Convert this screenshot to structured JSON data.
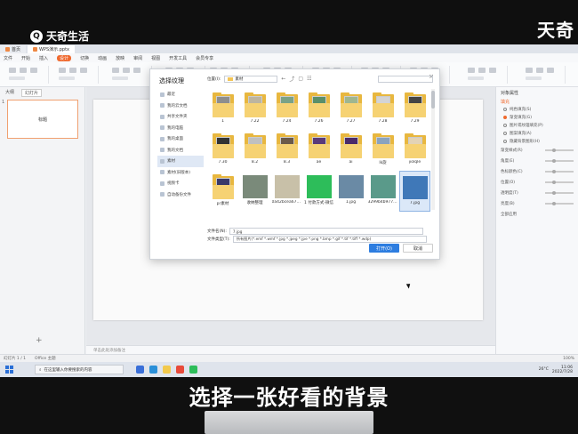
{
  "watermark": {
    "left_brand": "天奇生活",
    "right_brand": "天奇"
  },
  "window": {
    "tabs": [
      "首页",
      "WPS演示.pptx"
    ],
    "menu": [
      "文件",
      "开始",
      "插入",
      "设计",
      "切换",
      "动画",
      "放映",
      "审阅",
      "视图",
      "开发工具",
      "会员专享"
    ],
    "menu_highlight": "设计"
  },
  "left_panel": {
    "tabs": [
      "大纲",
      "幻灯片"
    ],
    "active_tab": "幻灯片",
    "thumb_title": "标题",
    "thumb_number": "1",
    "add_button": "+"
  },
  "notes_placeholder": "单击此处添加备注",
  "status_bar": {
    "slide_info": "幻灯片 1 / 1",
    "theme": "Office 主题",
    "zoom": "100%"
  },
  "right_panel": {
    "title": "对象属性",
    "section": "填充",
    "options": [
      {
        "label": "纯色填充(S)",
        "selected": false
      },
      {
        "label": "渐变填充(G)",
        "selected": true
      },
      {
        "label": "图片或纹理填充(P)",
        "selected": false
      },
      {
        "label": "图案填充(A)",
        "selected": false
      },
      {
        "label": "隐藏背景图形(H)",
        "selected": false
      }
    ],
    "rows": [
      "渐变样式(R)",
      "角度(E)",
      "色标颜色(C)",
      "位置(O)",
      "透明度(T)",
      "亮度(B)"
    ],
    "apply_all": "全部应用"
  },
  "dialog": {
    "title": "选择纹理",
    "location_label": "位置(I):",
    "location_value": "素材",
    "sidebar": [
      {
        "label": "最近",
        "selected": false
      },
      {
        "label": "我的云文档",
        "selected": false
      },
      {
        "label": "共享文件夹",
        "selected": false
      },
      {
        "label": "我的电脑",
        "selected": false
      },
      {
        "label": "我的桌面",
        "selected": false
      },
      {
        "label": "我的文档",
        "selected": false
      },
      {
        "label": "素材",
        "selected": true
      },
      {
        "label": "素材(旧版本)",
        "selected": false
      },
      {
        "label": "视频卡",
        "selected": false
      },
      {
        "label": "自动备份文件",
        "selected": false
      }
    ],
    "files": [
      {
        "name": "1",
        "kind": "folder",
        "art": "#8e8e8e"
      },
      {
        "name": "7.22",
        "kind": "folder",
        "art": "#bdb5a0"
      },
      {
        "name": "7.24",
        "kind": "folder",
        "art": "#7aa287"
      },
      {
        "name": "7.26",
        "kind": "folder",
        "art": "#5a8f6a"
      },
      {
        "name": "7.27",
        "kind": "folder",
        "art": "#9fb68f"
      },
      {
        "name": "7.28",
        "kind": "folder",
        "art": "#d4d4d4"
      },
      {
        "name": "7.29",
        "kind": "folder",
        "art": "#444444"
      },
      {
        "name": "7.30",
        "kind": "folder",
        "art": "#333333"
      },
      {
        "name": "8.2",
        "kind": "folder",
        "art": "#c0c0c0"
      },
      {
        "name": "8.3",
        "kind": "folder",
        "art": "#6b5a4a"
      },
      {
        "name": "ae",
        "kind": "folder",
        "art": "#5a3a7a"
      },
      {
        "name": "ai",
        "kind": "folder",
        "art": "#4a2a6a"
      },
      {
        "name": "lk旋",
        "kind": "folder",
        "art": "#8aa3bf"
      },
      {
        "name": "jiolqle",
        "kind": "folder",
        "art": "#e3d3b5"
      },
      {
        "name": "pr素材",
        "kind": "folder",
        "art": "#3a3a6a"
      },
      {
        "name": "收纳整理",
        "kind": "photo",
        "art": "#7a8a7a"
      },
      {
        "name": "0a42bcea67099...",
        "kind": "photo",
        "art": "#c8c0a8"
      },
      {
        "name": "1 付款方式-微信",
        "kind": "photo",
        "art": "#2dbd5a"
      },
      {
        "name": "1.jpg",
        "kind": "photo",
        "art": "#6a8aa5"
      },
      {
        "name": "3299b4b97703d...",
        "kind": "photo",
        "art": "#5a9a8a"
      },
      {
        "name": "7.jpg",
        "kind": "photo",
        "art": "#3f78b8"
      }
    ],
    "selected_file": "7.jpg",
    "filename_label": "文件名(N):",
    "filename_value": "7.jpg",
    "filetype_label": "文件类型(T):",
    "filetype_value": "所有图片(*.emf *.wmf *.jpg *.jpeg *.jpe *.png *.bmp *.gif *.tif *.tiff *.wdp)",
    "open_button": "打开(O)",
    "cancel_button": "取消"
  },
  "taskbar": {
    "search_placeholder": "在这里输入你要搜索的内容",
    "weather": "26°C",
    "time": "11:06",
    "date": "2022/7/28"
  },
  "subtitle": "选择一张好看的背景"
}
